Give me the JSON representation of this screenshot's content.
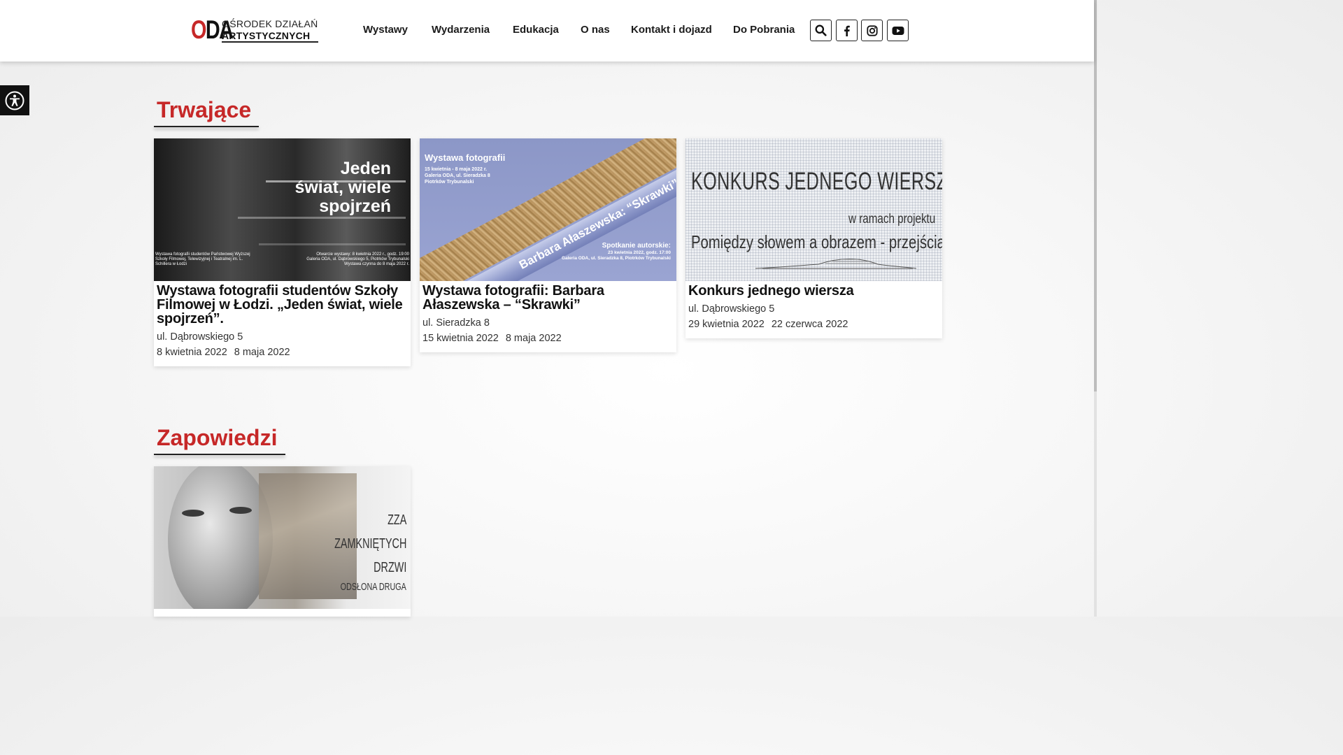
{
  "brand": {
    "logo_mark": "ODA",
    "line1": "OŚRODEK DZIAŁAŃ",
    "line2": "ARTYSTYCZNYCH"
  },
  "nav": {
    "items": [
      {
        "label": "Wystawy"
      },
      {
        "label": "Wydarzenia"
      },
      {
        "label": "Edukacja"
      },
      {
        "label": "O nas"
      },
      {
        "label": "Kontakt i dojazd"
      },
      {
        "label": "Do Pobrania"
      }
    ]
  },
  "header_icons": [
    "search-icon",
    "facebook-icon",
    "instagram-icon",
    "youtube-icon"
  ],
  "accessibility_icon": "accessibility-icon",
  "accent_color": "#c62828",
  "sections": {
    "ongoing": {
      "title": "Trwające",
      "cards": [
        {
          "title": "Wystawa fotografii studentów Szkoły Filmowej w Łodzi. „Jeden świat, wiele spojrzeń”.",
          "address": "ul. Dąbrowskiego 5",
          "date_start": "8 kwietnia 2022",
          "date_end": "8 maja 2022",
          "image": {
            "headline": "Jeden\nświat, wiele\nspojrzeń",
            "left_note": "Wystawa fotografii studentów Państwowej Wyższej Szkoły Filmowej, Telewizyjnej i Teatralnej im. L. Schillera w Łodzi",
            "right_note": "Otwarcie wystawy: 8 kwietnia 2022 r., godz. 19:00\nGaleria ODA, ul. Dąbrowskiego 5, Piotrków Trybunalski\nWystawa czynna do 8 maja 2022 r."
          }
        },
        {
          "title": "Wystawa fotografii: Barbara Ałaszewska – “Skrawki”",
          "address": "ul. Sieradzka 8",
          "date_start": "15 kwietnia 2022",
          "date_end": "8 maja 2022",
          "image": {
            "headline": "Wystawa fotografii",
            "subline": "15 kwietnia - 8 maja 2022 r.\nGaleria ODA, ul. Sieradzka 8\nPiotrków Trybunalski",
            "tube_text": "Barbara Ałaszewska: “Skrawki”",
            "meeting": "Spotkanie autorskie:",
            "meeting_details": "23 kwietnia 2022, godz. 17:00\nGaleria ODA, ul. Sieradzka 8, Piotrków Trybunalski"
          }
        },
        {
          "title": "Konkurs jednego wiersza",
          "address": "ul. Dąbrowskiego 5",
          "date_start": "29 kwietnia 2022",
          "date_end": "22 czerwca 2022",
          "image": {
            "headline": "KONKURS JEDNEGO WIERSZA",
            "subline": "w ramach projektu",
            "project": "Pomiędzy słowem a obrazem - przejścia"
          }
        }
      ]
    },
    "upcoming": {
      "title": "Zapowiedzi",
      "cards": [
        {
          "image": {
            "headline": "ZZA\nZAMKNIĘTYCH\nDRZWI",
            "subline": "ODSŁONA DRUGA"
          }
        }
      ]
    }
  }
}
